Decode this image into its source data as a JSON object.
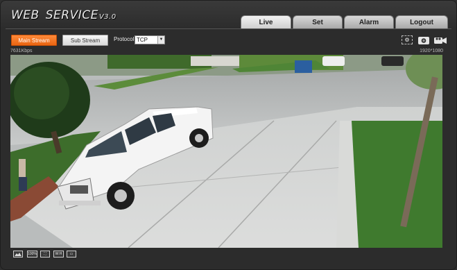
{
  "app": {
    "logo_main": "WEB",
    "logo_second": "SERVICE",
    "logo_version": "V3.0"
  },
  "tabs": [
    {
      "label": "Live",
      "active": true
    },
    {
      "label": "Set",
      "active": false
    },
    {
      "label": "Alarm",
      "active": false
    },
    {
      "label": "Logout",
      "active": false
    }
  ],
  "toolbar": {
    "main_stream_label": "Main Stream",
    "sub_stream_label": "Sub Stream",
    "protocol_label": "Protocol",
    "protocol_value": "TCP",
    "icons": [
      "settings-icon",
      "snapshot-camera-icon",
      "record-video-icon"
    ]
  },
  "stream_info": {
    "bitrate": "7631Kbps",
    "resolution": "1920*1080"
  },
  "bottom_controls": {
    "icons": [
      "image-adjust-icon",
      "zoom-100-icon",
      "fullscreen-icon",
      "aspect-ratio-icon",
      "fit-window-icon"
    ],
    "labels": [
      "",
      "100%",
      "",
      "W:H",
      ""
    ]
  },
  "colors": {
    "accent": "#ee6b1c",
    "background": "#2c2c2c"
  }
}
